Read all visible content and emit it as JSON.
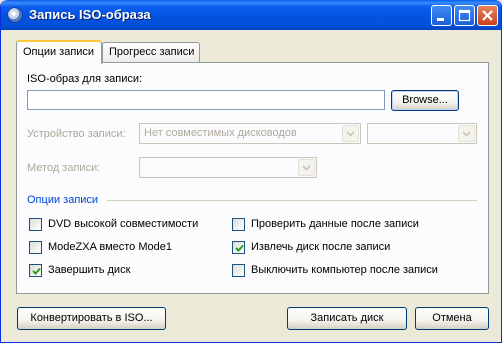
{
  "window": {
    "title": "Запись ISO-образа",
    "minimize_label": "_",
    "maximize_label": "□",
    "close_label": "×"
  },
  "tabs": [
    {
      "label": "Опции записи",
      "active": true
    },
    {
      "label": "Прогресс записи",
      "active": false
    }
  ],
  "iso": {
    "label": "ISO-образ для записи:",
    "value": "",
    "browse_label": "Browse..."
  },
  "device": {
    "label": "Устройство записи:",
    "selected": "Нет совместимых дисководов",
    "speed_selected": ""
  },
  "method": {
    "label": "Метод записи:",
    "selected": ""
  },
  "options": {
    "group_label": "Опции записи",
    "items": [
      {
        "label": "DVD высокой совместимости",
        "checked": false
      },
      {
        "label": "Проверить данные после записи",
        "checked": false
      },
      {
        "label": "ModeZXA вместо Mode1",
        "checked": false
      },
      {
        "label": "Извлечь диск после записи",
        "checked": true
      },
      {
        "label": "Завершить диск",
        "checked": true
      },
      {
        "label": "Выключить компьютер после записи",
        "checked": false
      }
    ]
  },
  "footer": {
    "convert_label": "Конвертировать в ISO...",
    "burn_label": "Записать диск",
    "cancel_label": "Отмена"
  },
  "colors": {
    "titlebar": "#0553e1",
    "accent_tab": "#ffc83c",
    "group_label": "#0046d5",
    "checkmark": "#21a121"
  }
}
